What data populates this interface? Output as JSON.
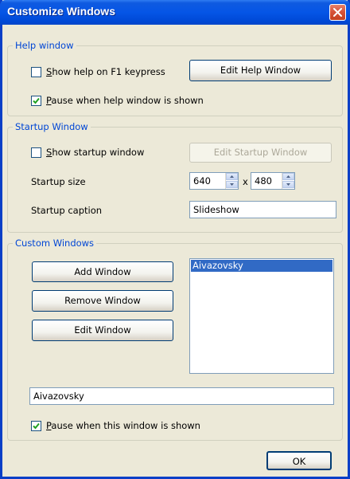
{
  "window": {
    "title": "Customize Windows"
  },
  "help_group": {
    "label": "Help window",
    "show_help_prefix": "S",
    "show_help_rest": "how help on F1 keypress",
    "show_help_checked": false,
    "edit_help_button": "Edit Help Window",
    "pause_prefix": "P",
    "pause_rest": "ause when help window is shown",
    "pause_checked": true
  },
  "startup_group": {
    "label": "Startup Window",
    "show_startup_prefix": "S",
    "show_startup_rest": "how startup window",
    "show_startup_checked": false,
    "edit_startup_button": "Edit Startup Window",
    "size_label": "Startup size",
    "width_value": "640",
    "times": "x",
    "height_value": "480",
    "caption_label": "Startup caption",
    "caption_value": "Slideshow"
  },
  "custom_group": {
    "label": "Custom Windows",
    "add_button": "Add Window",
    "remove_button": "Remove Window",
    "edit_button": "Edit Window",
    "list_items": [
      "Aivazovsky"
    ],
    "selected_index": 0,
    "name_value": "Aivazovsky",
    "pause_prefix": "P",
    "pause_rest": "ause when this window is shown",
    "pause_checked": true
  },
  "ok_button": "OK",
  "colors": {
    "title_bar": "#0555e6",
    "group_label": "#0046d5",
    "selection": "#316ac5",
    "close_button": "#d7543a",
    "check_mark": "#21a121"
  },
  "icons": {
    "close": "close-x-icon",
    "check": "check-mark-icon",
    "spin_up": "arrow-up-icon",
    "spin_down": "arrow-down-icon"
  }
}
